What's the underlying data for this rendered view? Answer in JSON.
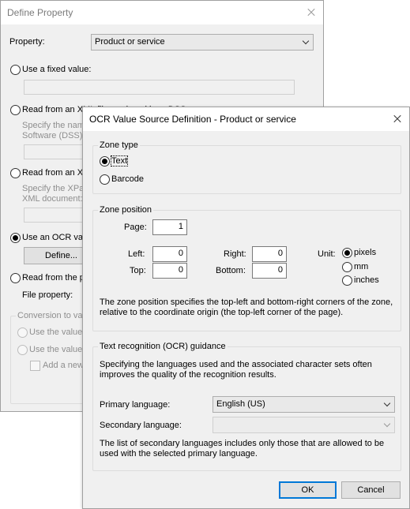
{
  "back": {
    "title": "Define Property",
    "property_label": "Property:",
    "property_value": "Product or service",
    "fixed_value_label": "Use a fixed value:",
    "fixed_value": "",
    "xml_label": "Read from an XML file produced by a DSS",
    "dss_hint_line1": "Specify the name",
    "dss_hint_line2": "Software (DSS):",
    "xpath_label": "Read from an XML",
    "xpath_hint_line1": "Specify the XPat",
    "xpath_hint_line2": "XML document:",
    "ocr_label": "Use an OCR valu",
    "define_button": "Define...",
    "read_from_label": "Read from the p",
    "file_property_label": "File property:",
    "conversion_group": "Conversion to val",
    "use_value_1": "Use the value",
    "use_value_2": "Use the value",
    "add_new_label": "Add a new"
  },
  "front": {
    "title": "OCR Value Source Definition - Product or service",
    "zone_type_group": "Zone type",
    "text_option": "Text",
    "barcode_option": "Barcode",
    "zone_position_group": "Zone position",
    "page_label": "Page:",
    "page_value": "1",
    "left_label": "Left:",
    "left_value": "0",
    "top_label": "Top:",
    "top_value": "0",
    "right_label": "Right:",
    "right_value": "0",
    "bottom_label": "Bottom:",
    "bottom_value": "0",
    "unit_label": "Unit:",
    "unit_pixels": "pixels",
    "unit_mm": "mm",
    "unit_inches": "inches",
    "zone_description_line1": "The zone position specifies the top-left and bottom-right corners of the zone,",
    "zone_description_line2": "relative to the coordinate origin (the top-left corner of the page).",
    "ocr_group": "Text recognition (OCR) guidance",
    "ocr_description_line1": "Specifying the languages used and the associated character sets often",
    "ocr_description_line2": "improves the quality of the recognition results.",
    "primary_language_label": "Primary language:",
    "primary_language_value": "English (US)",
    "secondary_language_label": "Secondary language:",
    "secondary_language_value": "",
    "secondary_note_line1": "The list of secondary languages includes only those that are allowed to be",
    "secondary_note_line2": "used with the selected primary language.",
    "ok_button": "OK",
    "cancel_button": "Cancel"
  },
  "colors": {
    "dialog_bg": "#f0f0f0",
    "titlebar_bg": "#ffffff",
    "default_button_border": "#0078d7",
    "disabled_text": "#8e8e8e"
  }
}
